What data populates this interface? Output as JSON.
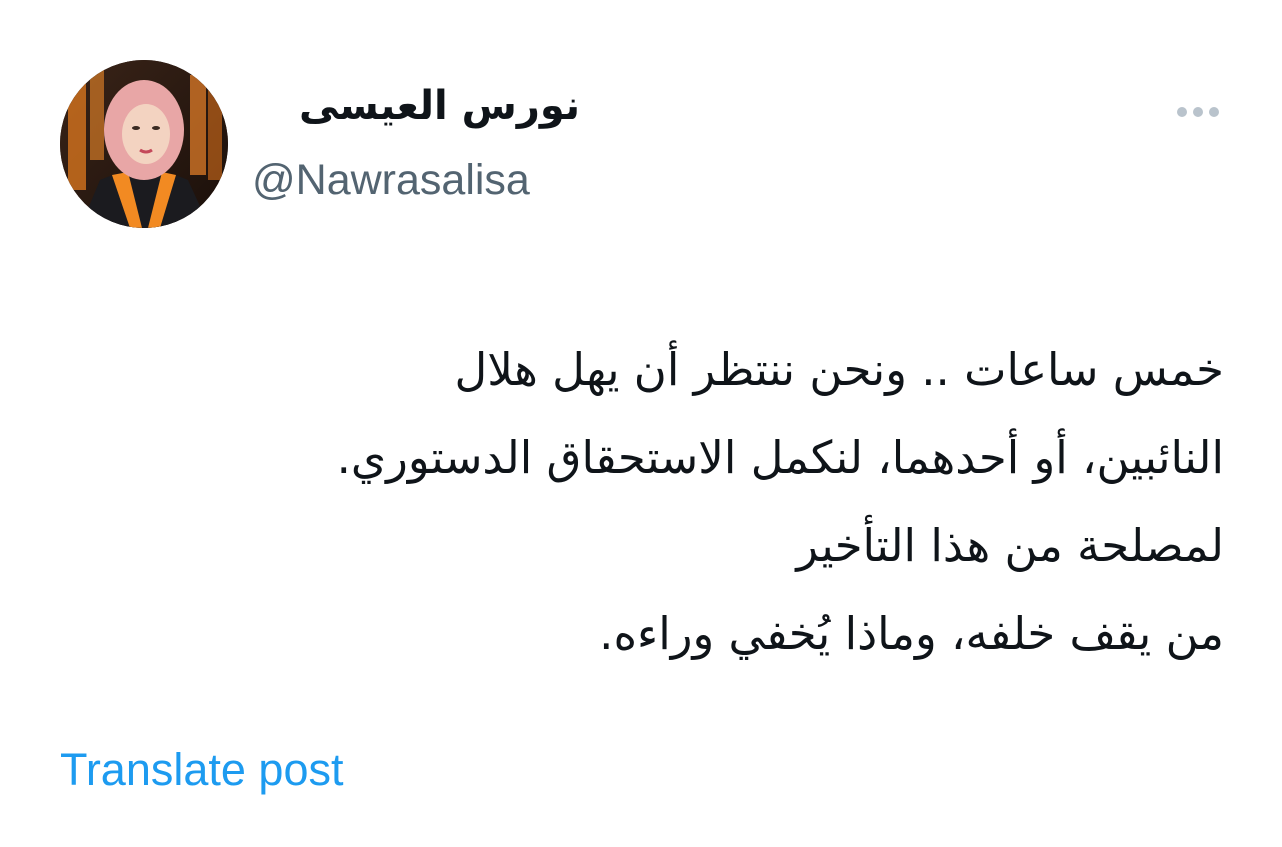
{
  "author": {
    "display_name": "نورس العيسى",
    "handle": "@Nawrasalisa",
    "avatar_icon": "profile-photo"
  },
  "post": {
    "lines": [
      "خمس ساعات .. ونحن ننتظر أن يهل هلال",
      "النائبين، أو أحدهما، لنكمل الاستحقاق الدستوري.",
      "لمصلحة من هذا التأخير",
      "من يقف خلفه، وماذا يُخفي وراءه."
    ]
  },
  "actions": {
    "more_icon": "more-horizontal-icon",
    "translate_label": "Translate post"
  },
  "colors": {
    "text_primary": "#0f1419",
    "text_secondary": "#536471",
    "link": "#1d9bf0",
    "background": "#ffffff"
  }
}
